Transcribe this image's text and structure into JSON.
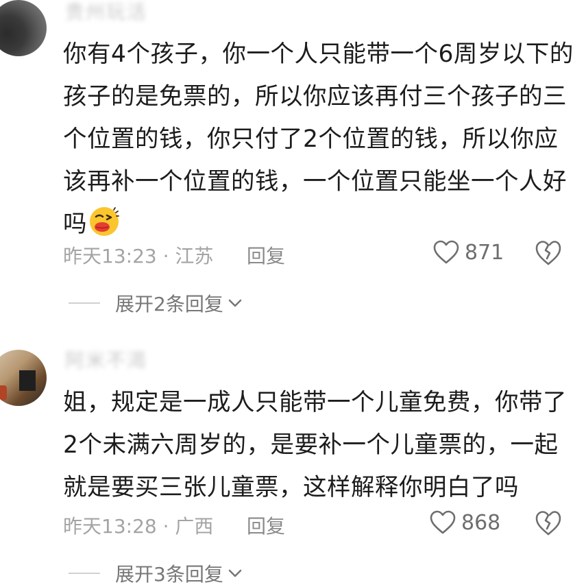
{
  "comments": [
    {
      "username": "贵州玩活",
      "text": "你有4个孩子，你一个人只能带一个6周岁以下的孩子的是免票的，所以你应该再付三个孩子的三个位置的钱，你只付了2个位置的钱，所以你应该再补一个位置的钱，一个位置只能坐一个人好吗",
      "emoji_icon": "kissing-face-emoji-icon",
      "meta": "昨天13:23 · 江苏",
      "reply_label": "回复",
      "likes": "871",
      "expand_label": "展开2条回复"
    },
    {
      "username": "阿米不渴",
      "text": "姐，规定是一成人只能带一个儿童免费，你带了2个未满六周岁的，是要补一个儿童票的，一起就是要买三张儿童票，这样解释你明白了吗",
      "meta": "昨天13:28 · 广西",
      "reply_label": "回复",
      "likes": "868",
      "expand_label": "展开3条回复"
    }
  ],
  "icons": {
    "like": "heart-outline-icon",
    "dislike": "broken-heart-icon",
    "expand": "chevron-down-icon"
  },
  "colors": {
    "text": "#1c1c1c",
    "meta": "#a4a4a4",
    "icon": "#6e6e6e"
  }
}
